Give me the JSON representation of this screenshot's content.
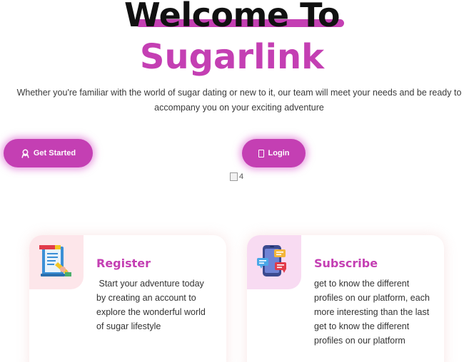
{
  "hero": {
    "title_line1": "Welcome To",
    "title_line2": "Sugarlink",
    "subtitle": "Whether you're familiar with the world of sugar dating or new to it, our team will meet your needs and be ready to accompany you on your exciting adventure"
  },
  "buttons": {
    "get_started": "Get Started",
    "login": "Login"
  },
  "broken_image": {
    "alt": "4"
  },
  "cards": [
    {
      "title": "Register",
      "text": " Start your adventure today by creating an account to explore the wonderful world of sugar lifestyle",
      "icon": "register-document-icon"
    },
    {
      "title": "Subscribe",
      "text": "get to know the different profiles on our platform, each more interesting than the last get to know the different profiles on our platform",
      "icon": "subscribe-phone-chat-icon"
    }
  ],
  "colors": {
    "accent": "#c43fb3",
    "register_tile": "#fde6ea",
    "subscribe_tile": "#f8dbf2"
  }
}
